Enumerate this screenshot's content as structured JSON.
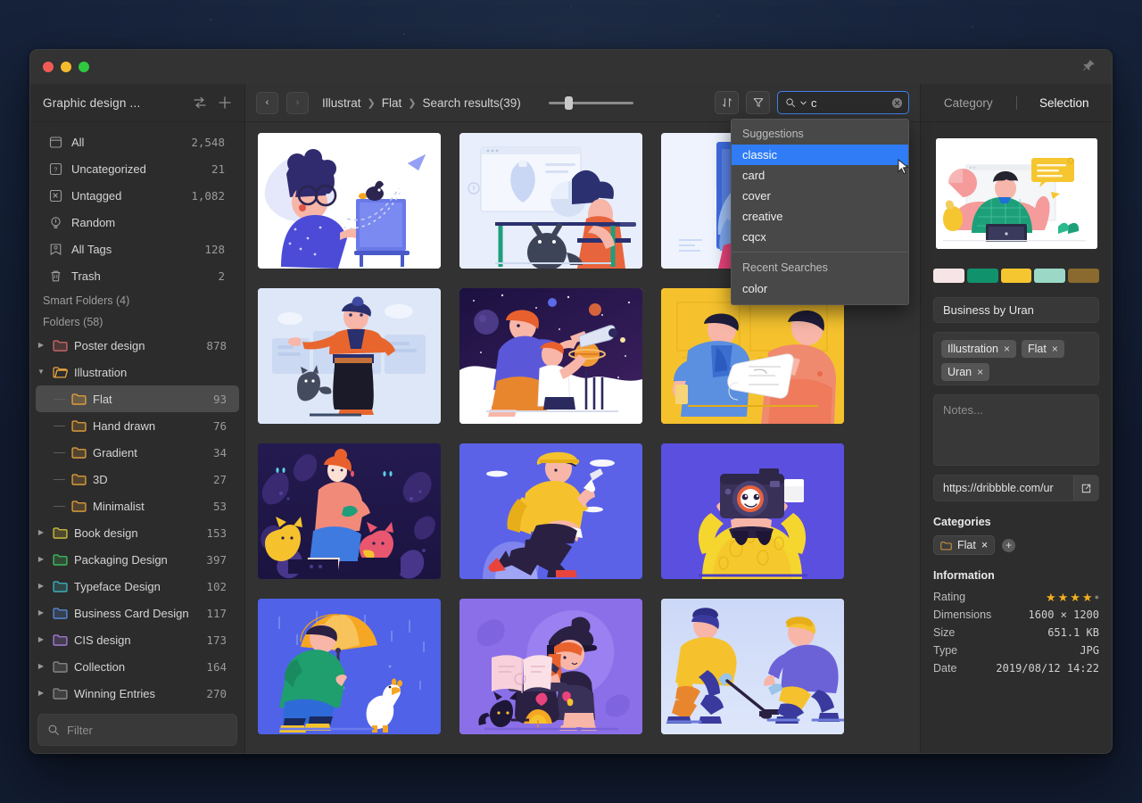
{
  "window": {
    "traffic_lights": [
      "close",
      "minimize",
      "maximize"
    ],
    "pin_icon": "pin-icon"
  },
  "sidebar": {
    "library_name": "Graphic design ...",
    "header_icons": [
      "sort-switch-icon",
      "plus-icon"
    ],
    "filter_placeholder": "Filter",
    "filter_value": "",
    "system_items": [
      {
        "label": "All",
        "count": "2,548",
        "icon": "all-icon"
      },
      {
        "label": "Uncategorized",
        "count": "21",
        "icon": "uncategorized-icon"
      },
      {
        "label": "Untagged",
        "count": "1,082",
        "icon": "untagged-icon"
      },
      {
        "label": "Random",
        "count": "",
        "icon": "random-icon"
      },
      {
        "label": "All Tags",
        "count": "128",
        "icon": "tags-icon"
      },
      {
        "label": "Trash",
        "count": "2",
        "icon": "trash-icon"
      }
    ],
    "smart_folders_header": "Smart Folders (4)",
    "folders_header": "Folders (58)",
    "folders": [
      {
        "label": "Poster design",
        "count": "878",
        "color": "#d46a6a",
        "expanded": false,
        "child": false,
        "selected": false
      },
      {
        "label": "Illustration",
        "count": "",
        "color": "#e8a33d",
        "expanded": true,
        "child": false,
        "selected": false
      },
      {
        "label": "Flat",
        "count": "93",
        "color": "#e8a33d",
        "expanded": null,
        "child": true,
        "selected": true
      },
      {
        "label": "Hand drawn",
        "count": "76",
        "color": "#e8a33d",
        "expanded": null,
        "child": true,
        "selected": false
      },
      {
        "label": "Gradient",
        "count": "34",
        "color": "#e8a33d",
        "expanded": null,
        "child": true,
        "selected": false
      },
      {
        "label": "3D",
        "count": "27",
        "color": "#e8a33d",
        "expanded": null,
        "child": true,
        "selected": false
      },
      {
        "label": "Minimalist",
        "count": "53",
        "color": "#e8a33d",
        "expanded": null,
        "child": true,
        "selected": false
      },
      {
        "label": "Book design",
        "count": "153",
        "color": "#d8c53f",
        "expanded": false,
        "child": false,
        "selected": false
      },
      {
        "label": "Packaging Design",
        "count": "397",
        "color": "#3fc45f",
        "expanded": false,
        "child": false,
        "selected": false
      },
      {
        "label": "Typeface Design",
        "count": "102",
        "color": "#3fb7c4",
        "expanded": false,
        "child": false,
        "selected": false
      },
      {
        "label": "Business Card Design",
        "count": "117",
        "color": "#5b8fe0",
        "expanded": false,
        "child": false,
        "selected": false
      },
      {
        "label": "CIS design",
        "count": "173",
        "color": "#a97fe0",
        "expanded": false,
        "child": false,
        "selected": false
      },
      {
        "label": "Collection",
        "count": "164",
        "color": "#8d8d8d",
        "expanded": false,
        "child": false,
        "selected": false
      },
      {
        "label": "Winning Entries",
        "count": "270",
        "color": "#8d8d8d",
        "expanded": false,
        "child": false,
        "selected": false
      }
    ]
  },
  "toolbar": {
    "back_label": "‹",
    "forward_label": "›",
    "breadcrumb": [
      "Illustrat",
      "Flat",
      "Search results(39)"
    ],
    "breadcrumb_separator": "❯",
    "zoom_percent": 20,
    "sort_icon": "sort-icon",
    "filter_icon": "filter-funnel-icon",
    "search": {
      "icon": "search-icon",
      "chevron": "chevron-down-icon",
      "value": "c",
      "clear_icon": "clear-circle-icon"
    }
  },
  "suggestions": {
    "suggestions_header": "Suggestions",
    "items": [
      "classic",
      "card",
      "cover",
      "creative",
      "cqcx"
    ],
    "active_index": 0,
    "recent_header": "Recent Searches",
    "recent": [
      "color"
    ],
    "highlight_color": "#2f7cf6"
  },
  "grid": {
    "items": [
      {
        "name": "woman-at-easel-with-bird",
        "bg": "#ffffff"
      },
      {
        "name": "person-at-desk-with-cat",
        "bg": "#e8eefc"
      },
      {
        "name": "person-with-pink-abstract",
        "bg": "#eef3fd"
      },
      {
        "name": "man-with-cat-city",
        "bg": "#dde7f8"
      },
      {
        "name": "father-child-telescope",
        "bg": "#ffffff"
      },
      {
        "name": "two-people-yellow-scroll",
        "bg": "#f5c22e"
      },
      {
        "name": "woman-with-cats-night-garden",
        "bg": "#2b1f58"
      },
      {
        "name": "running-delivery-man",
        "bg": "#5b62e8"
      },
      {
        "name": "person-with-camera-head",
        "bg": "#5b4fe0"
      },
      {
        "name": "man-umbrella-with-goose",
        "bg": "#4f62e8"
      },
      {
        "name": "witch-with-cauldron",
        "bg": "#8a6fe8"
      },
      {
        "name": "hockey-players",
        "bg": "#c5d2f5"
      }
    ]
  },
  "right_panel": {
    "tabs": [
      {
        "label": "Category",
        "active": false
      },
      {
        "label": "Selection",
        "active": true
      }
    ],
    "preview_name": "business-by-uran-preview",
    "palette": [
      "#f7e4e7",
      "#10926c",
      "#f5c62f",
      "#9bd9c6",
      "#8a6a2e"
    ],
    "title": "Business by Uran",
    "tags": [
      "Illustration",
      "Flat",
      "Uran"
    ],
    "tag_remove_glyph": "×",
    "notes_placeholder": "Notes...",
    "url": "https://dribbble.com/ur",
    "url_open_icon": "external-link-icon",
    "categories_header": "Categories",
    "category_chip": "Flat",
    "category_add_icon": "plus-circle-icon",
    "information_header": "Information",
    "info": [
      {
        "key": "Rating",
        "value": ""
      },
      {
        "key": "Dimensions",
        "value": "1600 × 1200"
      },
      {
        "key": "Size",
        "value": "651.1 KB"
      },
      {
        "key": "Type",
        "value": "JPG"
      },
      {
        "key": "Date",
        "value": "2019/08/12 14:22"
      }
    ],
    "rating_filled": 4,
    "rating_total": 5
  }
}
